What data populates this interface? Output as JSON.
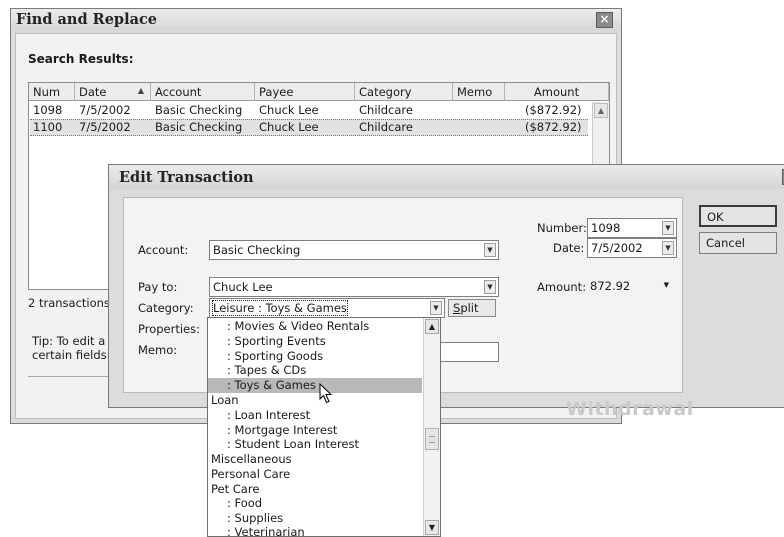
{
  "find_replace": {
    "title": "Find and Replace",
    "search_results_label": "Search Results:",
    "columns": [
      "Num",
      "Date",
      "Account",
      "Payee",
      "Category",
      "Memo",
      "Amount"
    ],
    "sort_indicator": "▲",
    "rows": [
      {
        "num": "1098",
        "date": "7/5/2002",
        "account": "Basic Checking",
        "payee": "Chuck Lee",
        "category": "Childcare",
        "memo": "",
        "amount": "($872.92)"
      },
      {
        "num": "1100",
        "date": "7/5/2002",
        "account": "Basic Checking",
        "payee": "Chuck Lee",
        "category": "Childcare",
        "memo": "",
        "amount": "($872.92)"
      }
    ],
    "count_label": "2 transactions",
    "tip_line1": "Tip: To edit a s",
    "tip_line2": "certain fields c"
  },
  "edit_transaction": {
    "title": "Edit Transaction",
    "account_label": "Account:",
    "account_value": "Basic Checking",
    "payto_label": "Pay to:",
    "payto_value": "Chuck Lee",
    "category_label": "Category:",
    "category_value": "Leisure : Toys & Games",
    "properties_label": "Properties:",
    "memo_label": "Memo:",
    "number_label": "Number:",
    "number_value": "1098",
    "date_label": "Date:",
    "date_value": "7/5/2002",
    "amount_label": "Amount:",
    "amount_value": "872.92",
    "split_label_u": "S",
    "split_label_rest": "plit",
    "ok_label": "OK",
    "cancel_label": "Cancel",
    "watermark": "Withdrawal",
    "close_glyph": "×"
  },
  "category_dropdown": {
    "items": [
      ": Movies & Video Rentals",
      ": Sporting Events",
      ": Sporting Goods",
      ": Tapes & CDs",
      ": Toys & Games",
      "Loan",
      ": Loan Interest",
      ": Mortgage Interest",
      ": Student Loan Interest",
      "Miscellaneous",
      "Personal Care",
      "Pet Care",
      ": Food",
      ": Supplies",
      ": Veterinarian"
    ],
    "highlighted_index": 4
  }
}
